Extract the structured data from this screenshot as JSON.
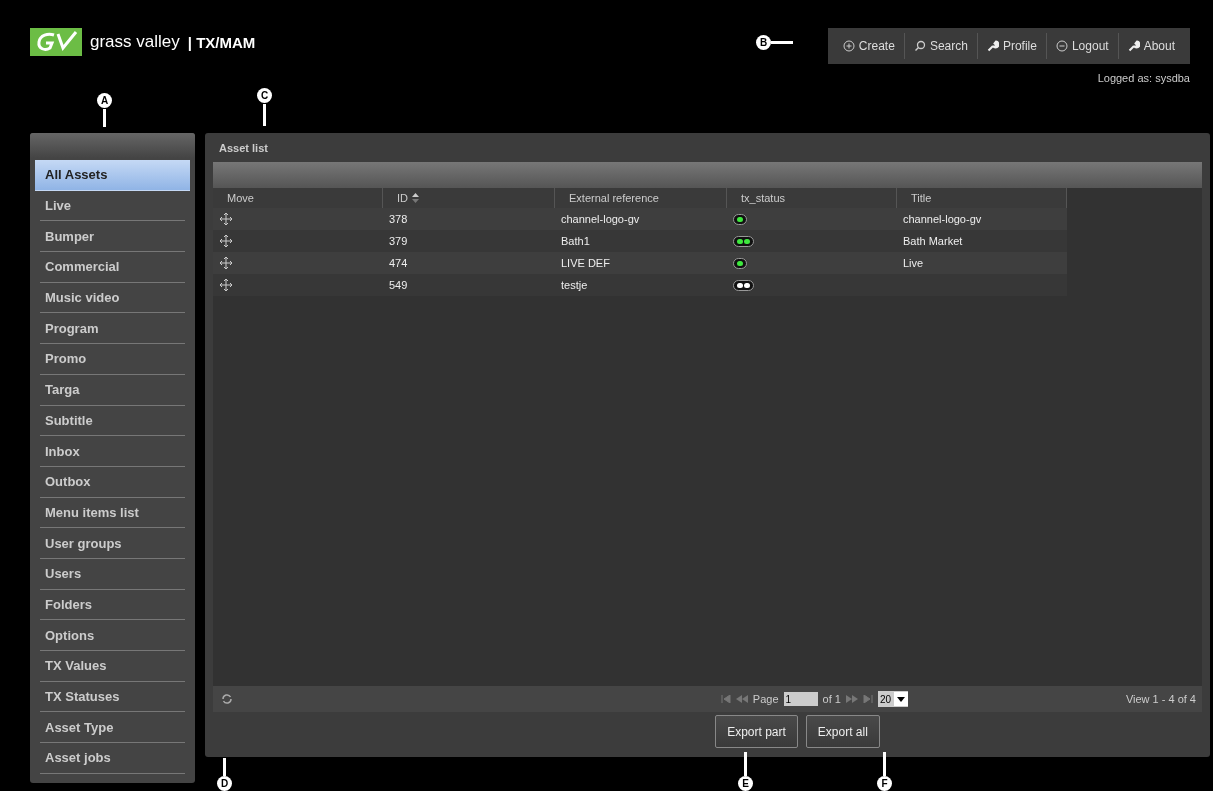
{
  "logo": {
    "brand": "grass valley",
    "product": "| TX/MAM"
  },
  "nav": [
    {
      "label": "Create"
    },
    {
      "label": "Search"
    },
    {
      "label": "Profile"
    },
    {
      "label": "Logout"
    },
    {
      "label": "About"
    }
  ],
  "logged_as": "Logged as: sysdba",
  "callouts": [
    {
      "letter": "A"
    },
    {
      "letter": "C"
    },
    {
      "letter": "B"
    },
    {
      "letter": "D"
    },
    {
      "letter": "E"
    },
    {
      "letter": "F"
    }
  ],
  "sidebar": {
    "items": [
      {
        "label": "All Assets",
        "selected": true
      },
      {
        "label": "Live",
        "selected": false
      },
      {
        "label": "Bumper",
        "selected": false
      },
      {
        "label": "Commercial",
        "selected": false
      },
      {
        "label": "Music video",
        "selected": false
      },
      {
        "label": "Program",
        "selected": false
      },
      {
        "label": "Promo",
        "selected": false
      },
      {
        "label": "Targa",
        "selected": false
      },
      {
        "label": "Subtitle",
        "selected": false
      },
      {
        "label": "Inbox",
        "selected": false
      },
      {
        "label": "Outbox",
        "selected": false
      },
      {
        "label": "Menu items list",
        "selected": false
      },
      {
        "label": "User groups",
        "selected": false
      },
      {
        "label": "Users",
        "selected": false
      },
      {
        "label": "Folders",
        "selected": false
      },
      {
        "label": "Options",
        "selected": false
      },
      {
        "label": "TX Values",
        "selected": false
      },
      {
        "label": "TX Statuses",
        "selected": false
      },
      {
        "label": "Asset Type",
        "selected": false
      },
      {
        "label": "Asset jobs",
        "selected": false
      }
    ]
  },
  "panel": {
    "title": "Asset list",
    "table": {
      "columns": [
        {
          "label": "Move",
          "sorted": false
        },
        {
          "label": "ID",
          "sorted": true
        },
        {
          "label": "External reference",
          "sorted": false
        },
        {
          "label": "tx_status",
          "sorted": false
        },
        {
          "label": "Title",
          "sorted": false
        }
      ],
      "rows": [
        {
          "id": "378",
          "external_reference": "channel-logo-gv",
          "tx_status": [
            {
              "lit": true
            }
          ],
          "title": "channel-logo-gv"
        },
        {
          "id": "379",
          "external_reference": "Bath1",
          "tx_status": [
            {
              "lit": true
            },
            {
              "lit": true
            }
          ],
          "title": "Bath Market"
        },
        {
          "id": "474",
          "external_reference": "LIVE DEF",
          "tx_status": [
            {
              "lit": true
            }
          ],
          "title": "Live"
        },
        {
          "id": "549",
          "external_reference": "testje",
          "tx_status": [
            {
              "lit": false
            },
            {
              "lit": false
            }
          ]
        }
      ]
    },
    "pager": {
      "page_label": "Page",
      "page": "1",
      "of": "of 1",
      "page_size": "20",
      "view": "View 1 - 4 of 4"
    },
    "buttons": [
      "Export part",
      "Export all"
    ]
  }
}
